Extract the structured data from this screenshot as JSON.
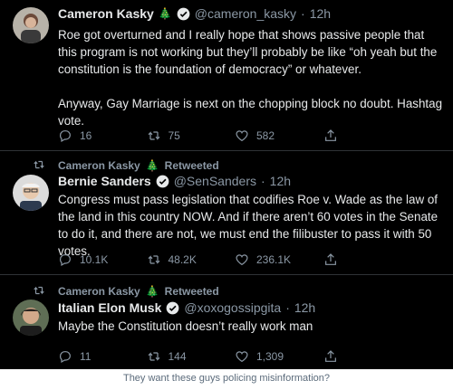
{
  "tweets": [
    {
      "name": "Cameron Kasky",
      "emoji": "🎄",
      "handle": "@cameron_kasky",
      "time": "12h",
      "text": [
        "Roe got overturned and I really hope that shows passive people that this program is not working but they’ll probably be like “oh yeah but the constitution is the foundation of democracy” or whatever.",
        "Anyway, Gay Marriage is next on the chopping block no doubt. Hashtag vote."
      ],
      "replies": "16",
      "retweets": "75",
      "likes": "582"
    },
    {
      "retweeted_by": "Cameron Kasky",
      "retweeted_emoji": "🎄",
      "retweeted_label": "Retweeted",
      "name": "Bernie Sanders",
      "handle": "@SenSanders",
      "time": "12h",
      "text": [
        "Congress must pass legislation that codifies Roe v. Wade as the law of the land in this country NOW. And if there aren’t 60 votes in the Senate to do it, and there are not, we must end the filibuster to pass it with 50 votes."
      ],
      "replies": "10.1K",
      "retweets": "48.2K",
      "likes": "236.1K"
    },
    {
      "retweeted_by": "Cameron Kasky",
      "retweeted_emoji": "🎄",
      "retweeted_label": "Retweeted",
      "name": "Italian Elon Musk",
      "handle": "@xoxogossipgita",
      "time": "12h",
      "text": [
        "Maybe the Constitution doesn’t really work man"
      ],
      "replies": "11",
      "retweets": "144",
      "likes": "1,309"
    }
  ],
  "separator": "·",
  "caption": "They want these guys policing misinformation?",
  "colors": {
    "background": "#000000",
    "text": "#e7e9ea",
    "muted": "#8b98a5",
    "verified": "#1d9bf0",
    "divider": "#2f3336"
  }
}
